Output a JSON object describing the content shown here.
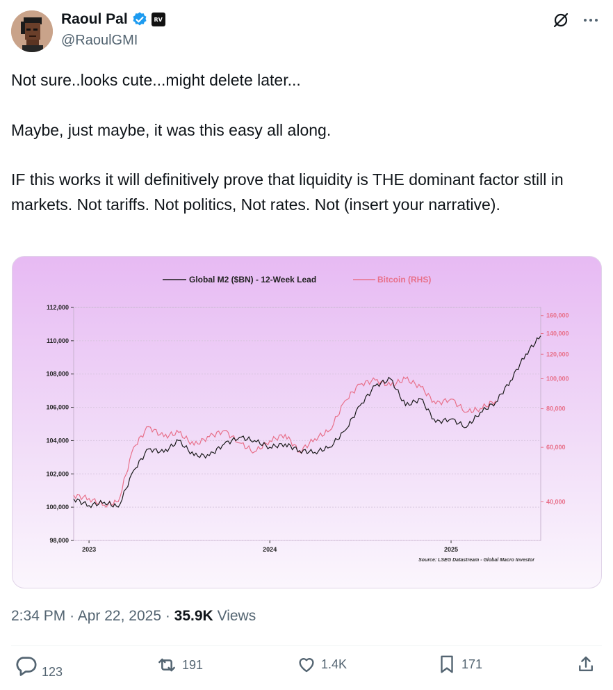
{
  "author": {
    "name": "Raoul Pal",
    "handle": "@RaoulGMI",
    "verified_icon": "verified-badge-icon",
    "affiliate_badge": "RV"
  },
  "tweet": {
    "paragraphs": [
      "Not sure..looks cute...might delete later...",
      "Maybe, just maybe, it was this easy all along.",
      "IF this works it will definitively prove that liquidity is THE dominant factor still in markets. Not tariffs. Not politics, Not rates. Not (insert your narrative)."
    ]
  },
  "meta": {
    "time": "2:34 PM",
    "date": "Apr 22, 2025",
    "views_count": "35.9K",
    "views_label": "Views"
  },
  "actions": {
    "replies": "123",
    "reposts": "191",
    "likes": "1.4K",
    "bookmarks": "171"
  },
  "colors": {
    "m2_line": "#1a1a1a",
    "btc_line": "#e8708a",
    "rhs_axis": "#e8708a",
    "media_gradient_top": "#e7baf3"
  },
  "chart_data": {
    "type": "line",
    "legend": [
      "Global M2 ($BN) - 12-Week Lead",
      "Bitcoin (RHS)"
    ],
    "legend_position": "top",
    "x_ticks": [
      "2023",
      "2024",
      "2025"
    ],
    "y_left_ticks": [
      "98,000",
      "100,000",
      "102,000",
      "104,000",
      "106,000",
      "108,000",
      "110,000",
      "112,000"
    ],
    "y_right_ticks": [
      "40,000",
      "60,000",
      "80,000",
      "100,000",
      "120,000",
      "140,000",
      "160,000"
    ],
    "ylim_left": [
      98000,
      112000
    ],
    "ylim_right": [
      30000,
      170000
    ],
    "y_right_scale": "log",
    "source": "Source: LSEG Datastream - Global Macro Investor",
    "grid": true,
    "series": [
      {
        "name": "Global M2 ($BN) - 12-Week Lead",
        "axis": "left",
        "x": [
          "2022-12",
          "2023-01",
          "2023-02",
          "2023-03",
          "2023-04",
          "2023-05",
          "2023-06",
          "2023-07",
          "2023-08",
          "2023-09",
          "2023-10",
          "2023-11",
          "2023-12",
          "2024-01",
          "2024-02",
          "2024-03",
          "2024-04",
          "2024-05",
          "2024-06",
          "2024-07",
          "2024-08",
          "2024-09",
          "2024-10",
          "2024-11",
          "2024-12",
          "2025-01",
          "2025-02",
          "2025-03",
          "2025-04",
          "2025-05",
          "2025-06",
          "2025-07"
        ],
        "values": [
          100500,
          100100,
          100300,
          100000,
          102200,
          103500,
          103300,
          104000,
          103100,
          103100,
          103800,
          104200,
          104000,
          103600,
          103800,
          103400,
          103300,
          103600,
          104600,
          106100,
          107300,
          107700,
          106100,
          106500,
          105100,
          105300,
          104800,
          105700,
          106300,
          107600,
          109200,
          110300
        ]
      },
      {
        "name": "Bitcoin (RHS)",
        "axis": "right",
        "x": [
          "2022-12",
          "2023-01",
          "2023-02",
          "2023-03",
          "2023-04",
          "2023-05",
          "2023-06",
          "2023-07",
          "2023-08",
          "2023-09",
          "2023-10",
          "2023-11",
          "2023-12",
          "2024-01",
          "2024-02",
          "2024-03",
          "2024-04",
          "2024-05",
          "2024-06",
          "2024-07",
          "2024-08",
          "2024-09",
          "2024-10",
          "2024-11",
          "2024-12",
          "2025-01",
          "2025-02",
          "2025-03",
          "2025-04"
        ],
        "values": [
          42000,
          41000,
          39000,
          40000,
          60000,
          70000,
          65000,
          67000,
          61000,
          65000,
          68000,
          62000,
          58000,
          63000,
          66000,
          58000,
          64000,
          68000,
          85000,
          96000,
          99000,
          95000,
          100000,
          94000,
          83000,
          86000,
          78000,
          80000,
          85000
        ]
      }
    ]
  }
}
